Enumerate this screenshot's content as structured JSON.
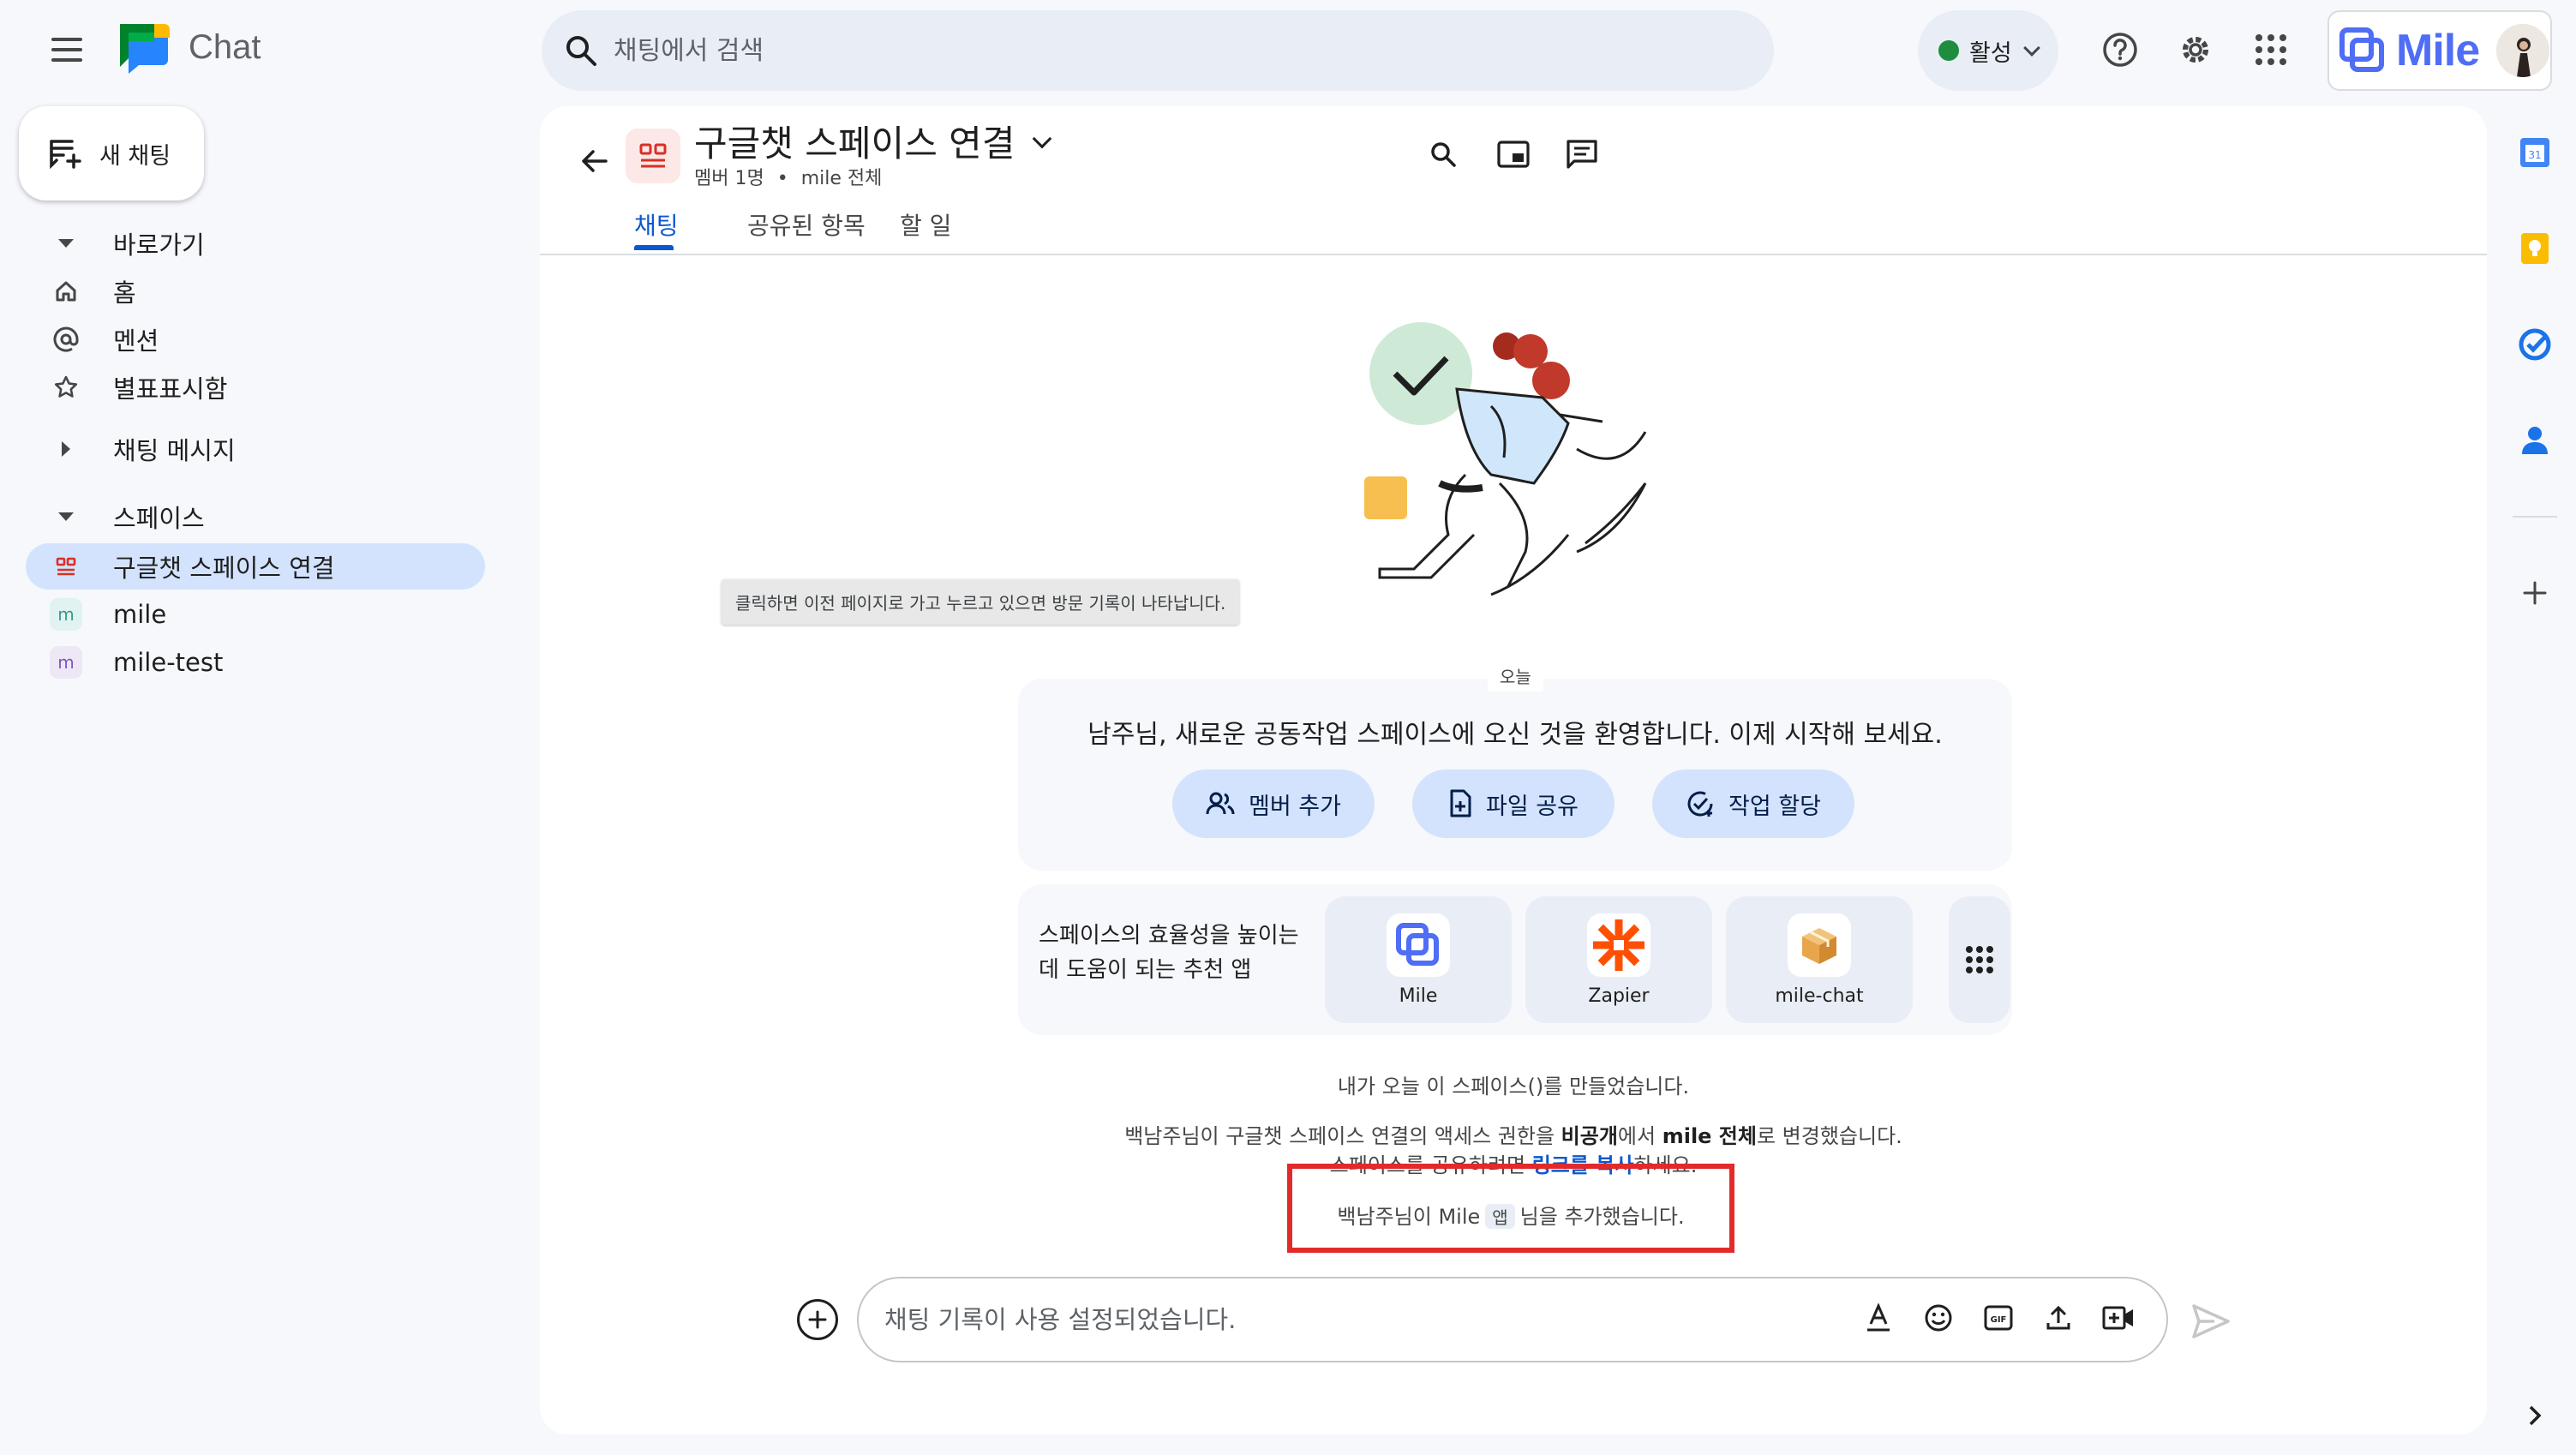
{
  "app": {
    "name": "Chat"
  },
  "search": {
    "placeholder": "채팅에서 검색"
  },
  "status": {
    "label": "활성",
    "color": "#1e8e3e"
  },
  "brand": {
    "name": "Mile"
  },
  "sidebar": {
    "new_chat": "새 채팅",
    "shortcuts_header": "바로가기",
    "shortcuts": [
      {
        "label": "홈",
        "icon": "home-icon"
      },
      {
        "label": "멘션",
        "icon": "at-icon"
      },
      {
        "label": "별표표시함",
        "icon": "star-icon"
      }
    ],
    "direct_header": "채팅 메시지",
    "spaces_header": "스페이스",
    "spaces": [
      {
        "label": "구글챗 스페이스 연결",
        "badge": "",
        "active": true
      },
      {
        "label": "mile",
        "badge": "m",
        "active": false
      },
      {
        "label": "mile-test",
        "badge": "m",
        "active": false
      }
    ]
  },
  "space": {
    "title": "구글챗 스페이스 연결",
    "members": "멤버 1명",
    "separator": "•",
    "access": "mile 전체",
    "tabs": [
      "채팅",
      "공유된 항목",
      "할 일"
    ]
  },
  "tooltip": "클릭하면 이전 페이지로 가고 누르고 있으면 방문 기록이 나타납니다.",
  "welcome": {
    "date_label": "오늘",
    "text": "남주님, 새로운 공동작업 스페이스에 오신 것을 환영합니다. 이제 시작해 보세요.",
    "buttons": [
      "멤버 추가",
      "파일 공유",
      "작업 할당"
    ]
  },
  "apps": {
    "text": "스페이스의 효율성을 높이는 데 도움이 되는 추천 앱",
    "items": [
      "Mile",
      "Zapier",
      "mile-chat"
    ]
  },
  "messages": {
    "created": "내가 오늘 이 스페이스()를 만들었습니다.",
    "access_changed_prefix": "백남주님이 구글챗 스페이스 연결의 액세스 권한을 ",
    "access_from": "비공개",
    "access_mid": "에서 ",
    "access_to": "mile 전체",
    "access_suffix": "로 변경했습니다.",
    "share_prefix": "스페이스를 공유하려면 ",
    "share_link": "링크를 복사",
    "share_suffix": "하세요.",
    "added_prefix": "백남주님이 Mile",
    "added_chip": "앱",
    "added_suffix": "님을 추가했습니다."
  },
  "composer": {
    "placeholder": "채팅 기록이 사용 설정되었습니다."
  },
  "colors": {
    "accent": "#0b57d0",
    "highlight": "#e32a2a",
    "active_nav": "#d3e3fd"
  }
}
